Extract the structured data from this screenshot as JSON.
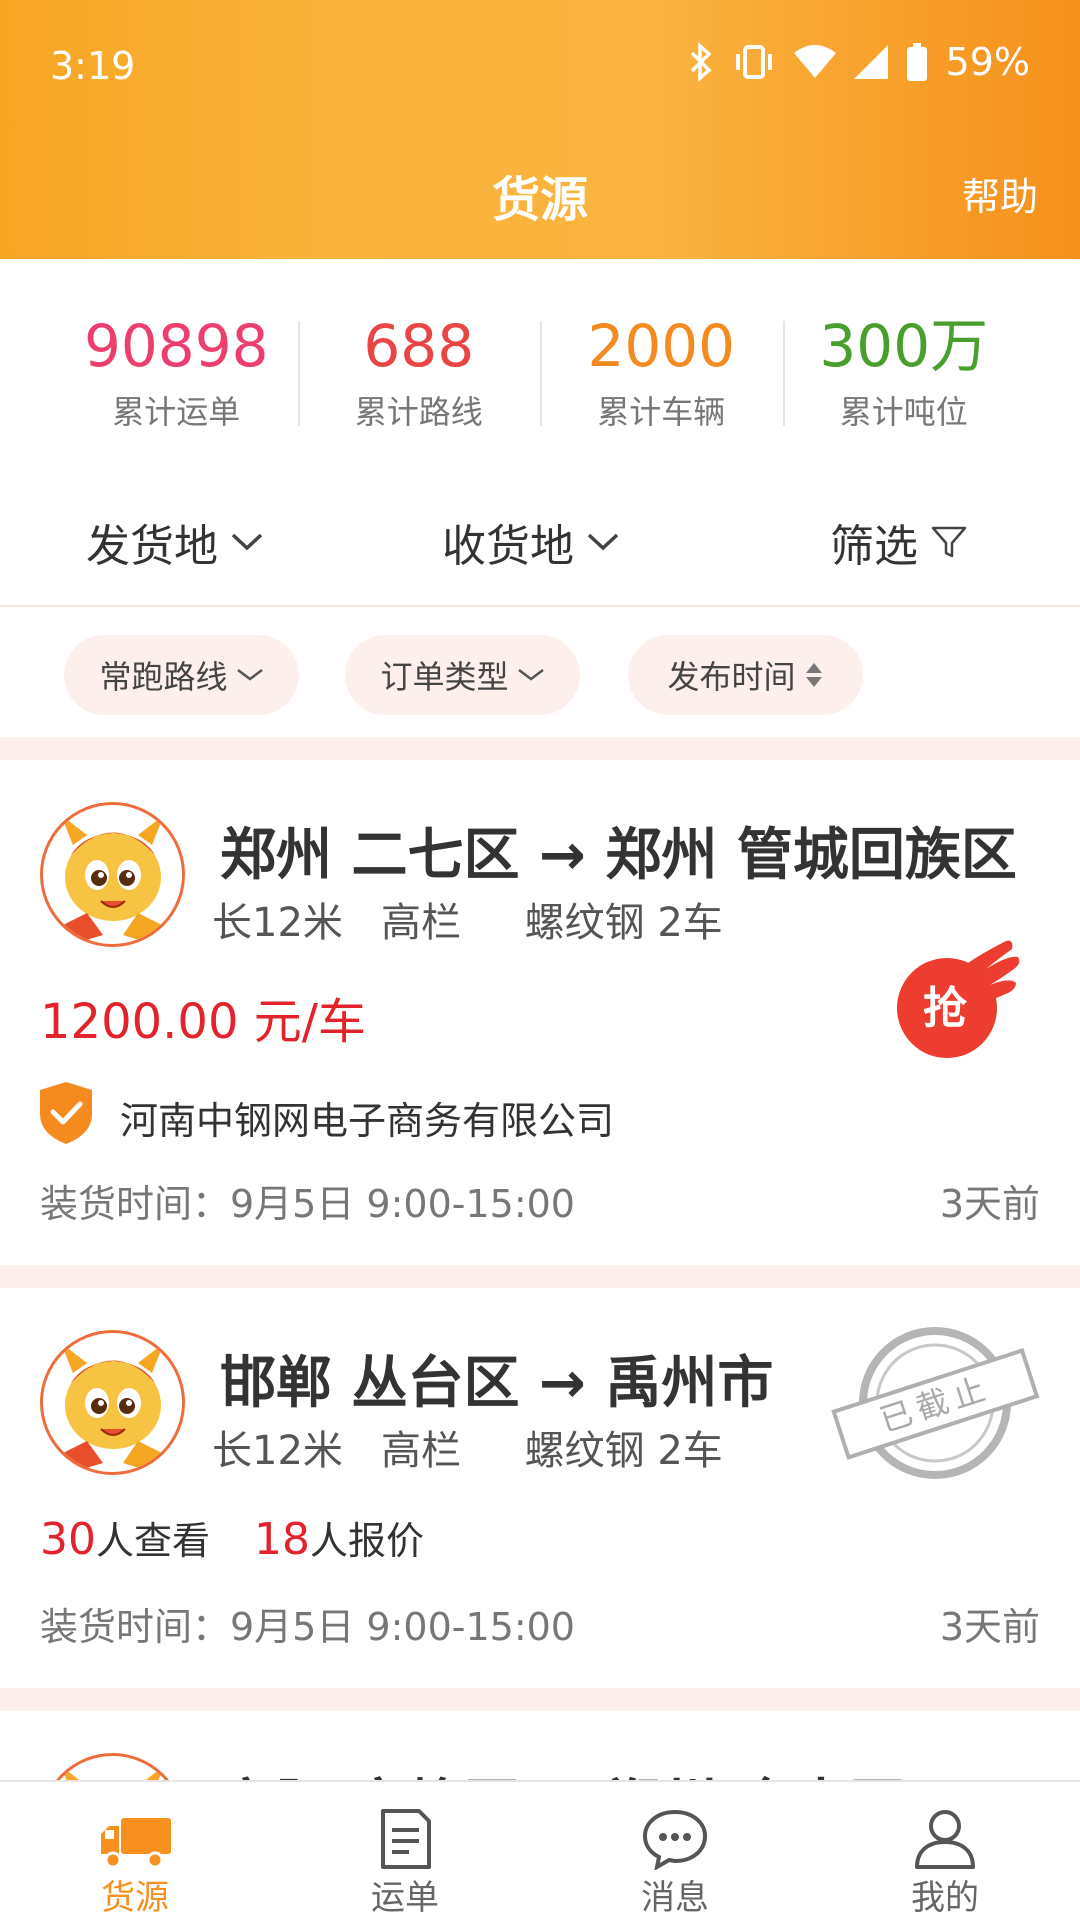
{
  "status_bar": {
    "time": "3:19",
    "battery": "59%"
  },
  "header": {
    "title": "货源",
    "help": "帮助"
  },
  "stats": [
    {
      "value": "90898",
      "label": "累计运单",
      "color": "#ec3f6e"
    },
    {
      "value": "688",
      "label": "累计路线",
      "color": "#e94545"
    },
    {
      "value": "2000",
      "label": "累计车辆",
      "color": "#f48b20"
    },
    {
      "value": "300万",
      "label": "累计吨位",
      "color": "#4a9e2e"
    }
  ],
  "filters": {
    "origin": "发货地",
    "destination": "收货地",
    "screen": "筛选"
  },
  "chips": {
    "route": "常跑路线",
    "order_type": "订单类型",
    "publish_time": "发布时间"
  },
  "cards": [
    {
      "route": "郑州 二七区 → 郑州 管城回族区",
      "specs": "长12米   高栏     螺纹钢 2车",
      "price": "1200.00 元/车",
      "grab": "抢",
      "company": "河南中钢网电子商务有限公司",
      "load_time": "装货时间：9月5日 9:00-15:00",
      "ago": "3天前"
    },
    {
      "route": "邯郸 丛台区 → 禹州市",
      "specs": "长12米   高栏     螺纹钢 2车",
      "views_num": "30",
      "views_label": "人查看",
      "quotes_num": "18",
      "quotes_label": "人报价",
      "stamp": "已截止",
      "load_time": "装货时间：9月5日 9:00-15:00",
      "ago": "3天前"
    },
    {
      "route": "安阳 文峰区 → 郑州 金水区"
    }
  ],
  "tabs": [
    {
      "label": "货源",
      "icon": "truck-icon",
      "active": true
    },
    {
      "label": "运单",
      "icon": "waybill-icon",
      "active": false
    },
    {
      "label": "消息",
      "icon": "message-icon",
      "active": false
    },
    {
      "label": "我的",
      "icon": "profile-icon",
      "active": false
    }
  ],
  "colors": {
    "brand": "#f7901e",
    "price": "#e2232b",
    "chip_bg": "#fdf0ec"
  }
}
